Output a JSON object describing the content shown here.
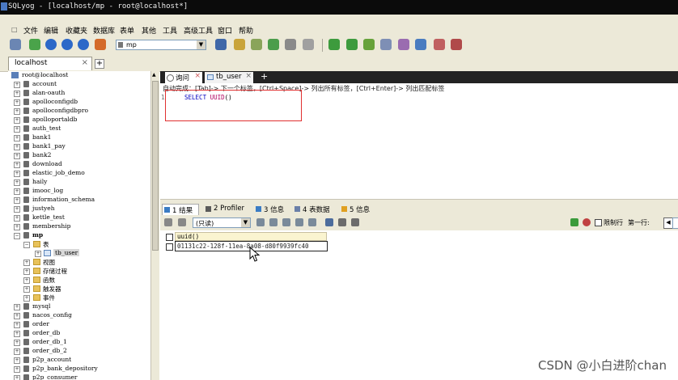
{
  "window": {
    "title": "SQLyog - [localhost/mp - root@localhost*]"
  },
  "menu": [
    "文件",
    "编辑",
    "收藏夹",
    "数据库",
    "表单",
    "其他",
    "工具",
    "高级工具",
    "窗口",
    "帮助"
  ],
  "toolbar": {
    "database_select": "mp"
  },
  "connection_tab": {
    "label": "localhost",
    "close": "×",
    "add": "+"
  },
  "object_browser": {
    "root": "root@localhost",
    "databases": [
      "account",
      "alan-oauth",
      "apolloconfigdb",
      "apolloconfigdbpro",
      "apolloportaldb",
      "auth_test",
      "bank1",
      "bank1_pay",
      "bank2",
      "download",
      "elastic_job_demo",
      "haily",
      "imooc_log",
      "information_schema",
      "justyeh",
      "kettle_test",
      "membership"
    ],
    "expanded_db": "mp",
    "expanded_children": {
      "tables_folder": "表",
      "table": "tb_user",
      "folders": [
        "视图",
        "存储过程",
        "函数",
        "触发器",
        "事件"
      ]
    },
    "databases_after": [
      "mysql",
      "nacos_config",
      "order",
      "order_db",
      "order_db_1",
      "order_db_2",
      "p2p_account",
      "p2p_bank_depository",
      "p2p_consumer"
    ]
  },
  "query_tabs": {
    "tab1": "询问",
    "tab2": "tb_user",
    "close": "×",
    "add": "+"
  },
  "editor": {
    "hint": "自动完成：[Tab]-> 下一个标签，[Ctrl+Space]-> 列出所有标签，[Ctrl+Enter]-> 列出匹配标签",
    "line_number": "1",
    "sql_keyword": "SELECT",
    "sql_function": "UUID",
    "sql_rest": "()"
  },
  "result_tabs": [
    {
      "num": "1",
      "label": "结果"
    },
    {
      "num": "2",
      "label": "Profiler"
    },
    {
      "num": "3",
      "label": "信息"
    },
    {
      "num": "4",
      "label": "表数据"
    },
    {
      "num": "5",
      "label": "信息"
    }
  ],
  "result_toolbar": {
    "mode": "(只读)",
    "limit_label": "限制行",
    "first_row_label": "第一行:",
    "prev": "◀"
  },
  "result_grid": {
    "column": "uuid()",
    "value": "01131c22-128f-11ea-8a08-d80f9939fc40"
  },
  "watermark": "CSDN @小白进阶chan"
}
